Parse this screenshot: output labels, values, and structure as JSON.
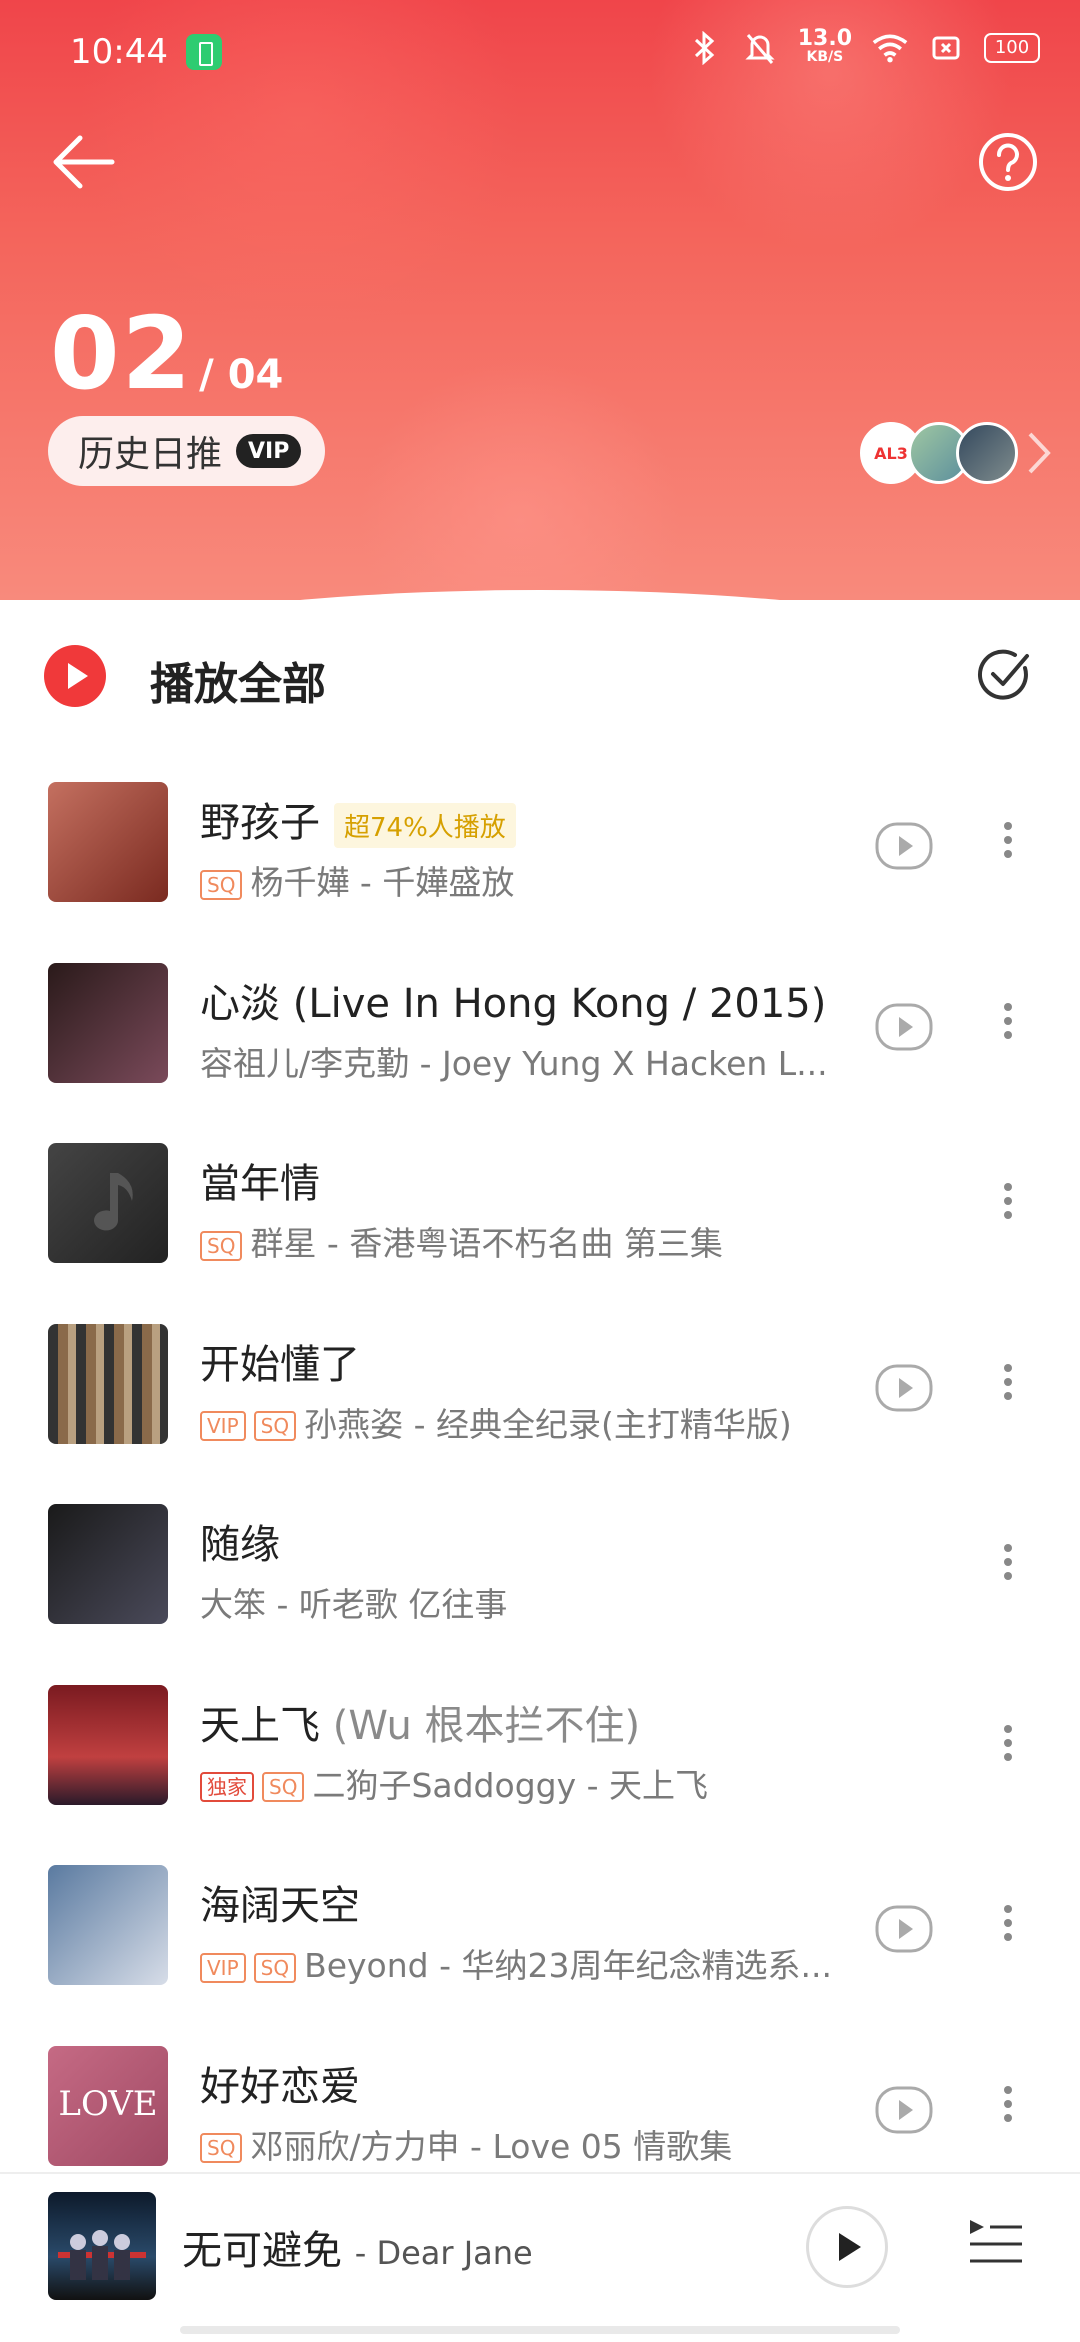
{
  "status_bar": {
    "time": "10:44",
    "net_speed_value": "13.0",
    "net_speed_unit": "KB/S",
    "battery": "100"
  },
  "header": {
    "day": "02",
    "month": "/ 04",
    "history_pill_label": "历史日推",
    "vip_badge": "VIP",
    "avatar_1_text": "AL3"
  },
  "play_all": {
    "label": "播放全部"
  },
  "songs": [
    {
      "title": "野孩子",
      "alias": "",
      "hot_tag": "超74%人播放",
      "tags": [
        "SQ"
      ],
      "subtitle": "杨千嬅 - 千嬅盛放",
      "has_mv": true
    },
    {
      "title": "心淡 (Live In Hong Kong / 2015)",
      "alias": "",
      "hot_tag": "",
      "tags": [],
      "subtitle": "容祖儿/李克勤 - Joey Yung X Hacken L...",
      "has_mv": true
    },
    {
      "title": "當年情",
      "alias": "",
      "hot_tag": "",
      "tags": [
        "SQ"
      ],
      "subtitle": "群星 - 香港粤语不朽名曲 第三集",
      "has_mv": false
    },
    {
      "title": "开始懂了",
      "alias": "",
      "hot_tag": "",
      "tags": [
        "VIP",
        "SQ"
      ],
      "subtitle": "孙燕姿 - 经典全纪录(主打精华版)",
      "has_mv": true
    },
    {
      "title": "随缘",
      "alias": "",
      "hot_tag": "",
      "tags": [],
      "subtitle": "大笨 - 听老歌 亿往事",
      "has_mv": false
    },
    {
      "title": "天上飞",
      "alias": "(Wu 根本拦不住)",
      "hot_tag": "",
      "tags": [
        "独家",
        "SQ"
      ],
      "subtitle": "二狗子Saddoggy - 天上飞",
      "has_mv": false
    },
    {
      "title": "海阔天空",
      "alias": "",
      "hot_tag": "",
      "tags": [
        "VIP",
        "SQ"
      ],
      "subtitle": "Beyond - 华纳23周年纪念精选系...",
      "has_mv": true
    },
    {
      "title": "好好恋爱",
      "alias": "",
      "hot_tag": "",
      "tags": [
        "SQ"
      ],
      "subtitle": "邓丽欣/方力申 - Love 05 情歌集",
      "has_mv": true,
      "cover_text": "LOVE"
    }
  ],
  "mini_player": {
    "title": "无可避免",
    "artist": "- Dear Jane"
  },
  "colors": {
    "accent": "#f0393a",
    "header_top": "#f0454a",
    "header_bottom": "#f88a7c",
    "hot_tag": "#d6a000",
    "quality_tag": "#f08a5d"
  }
}
